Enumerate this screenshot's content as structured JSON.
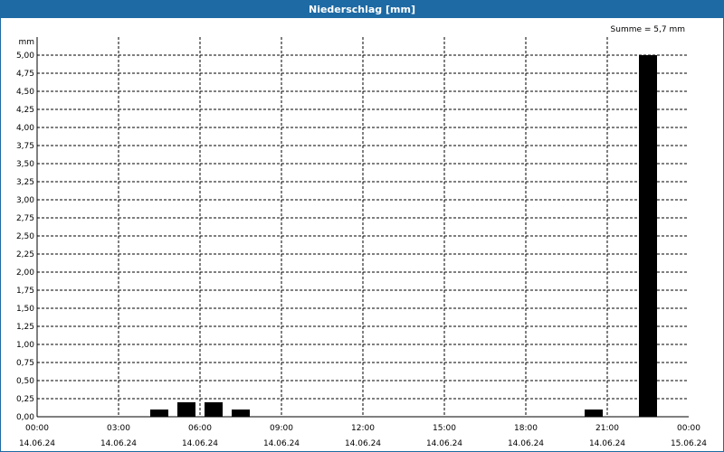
{
  "window": {
    "title": "Niederschlag [mm]"
  },
  "chart_data": {
    "type": "bar",
    "title": "Niederschlag [mm]",
    "ylabel": "mm",
    "xlabel": "",
    "annotation": "Summe = 5,7 mm",
    "ylim": [
      0,
      5.25
    ],
    "xlim_hours": [
      0,
      24
    ],
    "grid": true,
    "bar_color": "#000000",
    "grid_color": "#000000",
    "y_ticks": [
      "0,00",
      "0,25",
      "0,50",
      "0,75",
      "1,00",
      "1,25",
      "1,50",
      "1,75",
      "2,00",
      "2,25",
      "2,50",
      "2,75",
      "3,00",
      "3,25",
      "3,50",
      "3,75",
      "4,00",
      "4,25",
      "4,50",
      "4,75",
      "5,00"
    ],
    "x_ticks": [
      {
        "time": "00:00",
        "date": "14.06.24"
      },
      {
        "time": "03:00",
        "date": "14.06.24"
      },
      {
        "time": "06:00",
        "date": "14.06.24"
      },
      {
        "time": "09:00",
        "date": "14.06.24"
      },
      {
        "time": "12:00",
        "date": "14.06.24"
      },
      {
        "time": "15:00",
        "date": "14.06.24"
      },
      {
        "time": "18:00",
        "date": "14.06.24"
      },
      {
        "time": "21:00",
        "date": "14.06.24"
      },
      {
        "time": "00:00",
        "date": "15.06.24"
      }
    ],
    "bars": [
      {
        "hour": 4,
        "value": 0.1
      },
      {
        "hour": 5,
        "value": 0.2
      },
      {
        "hour": 6,
        "value": 0.2
      },
      {
        "hour": 7,
        "value": 0.1
      },
      {
        "hour": 20,
        "value": 0.1
      },
      {
        "hour": 22,
        "value": 5.0
      }
    ]
  }
}
